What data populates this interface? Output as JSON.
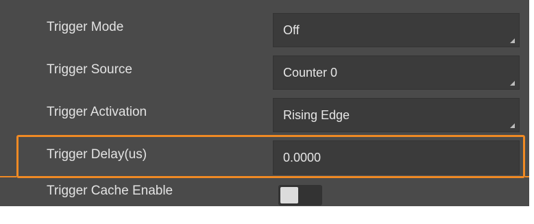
{
  "trigger_settings": {
    "rows": [
      {
        "label": "Trigger Mode",
        "value": "Off",
        "control": "dropdown"
      },
      {
        "label": "Trigger Source",
        "value": "Counter 0",
        "control": "dropdown"
      },
      {
        "label": "Trigger Activation",
        "value": "Rising Edge",
        "control": "dropdown"
      },
      {
        "label": "Trigger Delay(us)",
        "value": "0.0000",
        "control": "text-input",
        "highlighted": true
      },
      {
        "label": "Trigger Cache Enable",
        "enabled": false,
        "control": "toggle"
      }
    ]
  },
  "colors": {
    "panel_background": "#4a4a4a",
    "control_background": "#3b3b3b",
    "highlight": "#f08a24",
    "text": "#e3e3e3"
  },
  "icons": {
    "dropdown": "dropdown-corner-arrow-icon"
  }
}
